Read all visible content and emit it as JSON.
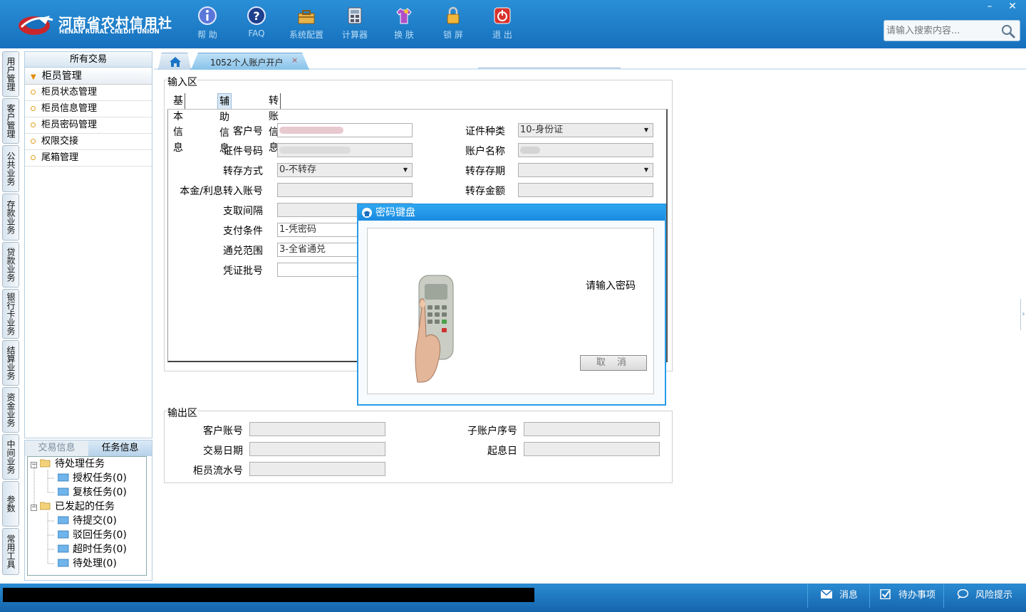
{
  "header": {
    "logo_cn": "河南省农村信用社",
    "logo_en": "HENAN RURAL CREDIT UNION",
    "toolbar": [
      {
        "label": "帮 助",
        "icon": "info-icon"
      },
      {
        "label": "FAQ",
        "icon": "question-icon"
      },
      {
        "label": "系统配置",
        "icon": "toolbox-icon"
      },
      {
        "label": "计算器",
        "icon": "calculator-icon"
      },
      {
        "label": "换 肤",
        "icon": "shirt-icon"
      },
      {
        "label": "锁 屏",
        "icon": "lock-icon"
      },
      {
        "label": "退 出",
        "icon": "power-icon"
      }
    ],
    "search_placeholder": "请输入搜索内容...",
    "minimize": "–",
    "close": "✕"
  },
  "vtabs": [
    "用户管理",
    "客户管理",
    "公共业务",
    "存款业务",
    "贷款业务",
    "银行卡业务",
    "结算业务",
    "资金业务",
    "中间业务",
    "参数",
    "常用工具"
  ],
  "menu": {
    "header": "所有交易",
    "group": "柜员管理",
    "items": [
      "柜员状态管理",
      "柜员信息管理",
      "柜员密码管理",
      "权限交接",
      "尾箱管理"
    ]
  },
  "tasks": {
    "tab_trade": "交易信息",
    "tab_task": "任务信息",
    "tree": [
      {
        "label": "待处理任务",
        "level": 0
      },
      {
        "label": "授权任务(0)",
        "level": 1
      },
      {
        "label": "复核任务(0)",
        "level": 1
      },
      {
        "label": "已发起的任务",
        "level": 0
      },
      {
        "label": "待提交(0)",
        "level": 1
      },
      {
        "label": "驳回任务(0)",
        "level": 1
      },
      {
        "label": "超时任务(0)",
        "level": 1
      },
      {
        "label": "待处理(0)",
        "level": 1
      }
    ]
  },
  "tabs": {
    "active": "1052个人账户开户",
    "close": "×"
  },
  "input_area": {
    "title": "输入区",
    "subtabs": [
      "基本信息",
      "辅助信息",
      "转账信息"
    ],
    "fields": {
      "customer_no": {
        "label": "客户号",
        "value": ""
      },
      "id_type": {
        "label": "证件种类",
        "value": "10-身份证"
      },
      "id_no": {
        "label": "证件号码",
        "value": ""
      },
      "account_name": {
        "label": "账户名称",
        "value": ""
      },
      "rollover_mode": {
        "label": "转存方式",
        "value": "0-不转存"
      },
      "rollover_term": {
        "label": "转存存期",
        "value": ""
      },
      "transfer_account": {
        "label": "本金/利息转入账号",
        "value": ""
      },
      "transfer_amount": {
        "label": "转存金额",
        "value": ""
      },
      "withdraw_interval": {
        "label": "支取间隔",
        "value": ""
      },
      "pay_condition": {
        "label": "支付条件",
        "value": "1-凭密码"
      },
      "exchange_range": {
        "label": "通兑范围",
        "value": "3-全省通兑"
      },
      "voucher_batch": {
        "label": "凭证批号",
        "value": ""
      }
    }
  },
  "output_area": {
    "title": "输出区",
    "fields": {
      "customer_account": {
        "label": "客户账号",
        "value": ""
      },
      "sub_account_no": {
        "label": "子账户序号",
        "value": ""
      },
      "trade_date": {
        "label": "交易日期",
        "value": ""
      },
      "value_date": {
        "label": "起息日",
        "value": ""
      },
      "teller_serial": {
        "label": "柜员流水号",
        "value": ""
      }
    }
  },
  "dialog": {
    "title": "密码键盘",
    "message": "请输入密码",
    "cancel": "取 消"
  },
  "statusbar": {
    "message": "消息",
    "todo": "待办事项",
    "risk": "风险提示"
  },
  "colors": {
    "header_blue": "#1670bd",
    "dialog_border": "#2a9cea"
  }
}
